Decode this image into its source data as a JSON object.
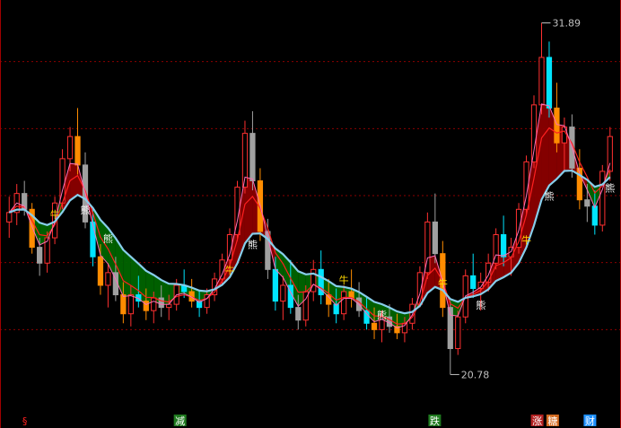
{
  "chart_data": {
    "type": "candlestick",
    "title": "",
    "price_max_label": "31.89",
    "price_min_label": "20.78",
    "y_range": [
      19.8,
      32.5
    ],
    "grid": {
      "horizontal_dashed": true,
      "color": "#8b0000"
    },
    "colors": {
      "background": "#000000",
      "candle_up": "#ff3030",
      "candle_down_a": "#00e5ff",
      "candle_down_b": "#ff8c00",
      "candle_neutral": "#a0a0a0",
      "band_bull": "#8b0000",
      "band_bear": "#006400",
      "ma_slow": "#87ceeb",
      "ma_fast": "#ff6fb5",
      "ma_mid": "#ff2020",
      "ma_bear": "#00a000"
    },
    "signals": [
      {
        "index": 6,
        "text": "牛",
        "kind": "bull"
      },
      {
        "index": 10,
        "text": "熊",
        "kind": "bear"
      },
      {
        "index": 13,
        "text": "熊",
        "kind": "bear"
      },
      {
        "index": 29,
        "text": "牛",
        "kind": "bull"
      },
      {
        "index": 32,
        "text": "熊",
        "kind": "bear"
      },
      {
        "index": 44,
        "text": "牛",
        "kind": "bull"
      },
      {
        "index": 49,
        "text": "熊",
        "kind": "bear"
      },
      {
        "index": 57,
        "text": "牛",
        "kind": "bull"
      },
      {
        "index": 62,
        "text": "熊",
        "kind": "bear"
      },
      {
        "index": 68,
        "text": "牛",
        "kind": "bull"
      },
      {
        "index": 71,
        "text": "熊",
        "kind": "bear"
      },
      {
        "index": 83,
        "text": "熊",
        "kind": "bear"
      }
    ],
    "bottom_markers": [
      {
        "x_frac": 0.04,
        "text": "§",
        "bg": "#000000",
        "fg": "#ff2020"
      },
      {
        "x_frac": 0.29,
        "text": "减",
        "bg": "#1f7a1f",
        "fg": "#ffffff"
      },
      {
        "x_frac": 0.7,
        "text": "跌",
        "bg": "#1f7a1f",
        "fg": "#ffffff"
      },
      {
        "x_frac": 0.865,
        "text": "涨",
        "bg": "#b22222",
        "fg": "#ffffff"
      },
      {
        "x_frac": 0.89,
        "text": "糖",
        "bg": "#d2691e",
        "fg": "#ffffff"
      },
      {
        "x_frac": 0.95,
        "text": "财",
        "bg": "#1e90ff",
        "fg": "#ffffff"
      }
    ],
    "candles": [
      [
        25.6,
        26.4,
        25.1,
        25.9
      ],
      [
        25.9,
        26.8,
        25.5,
        26.5
      ],
      [
        26.5,
        26.9,
        25.8,
        26.0
      ],
      [
        26.0,
        26.2,
        24.6,
        24.8
      ],
      [
        24.8,
        25.1,
        23.9,
        24.3
      ],
      [
        24.3,
        25.3,
        24.0,
        25.1
      ],
      [
        25.1,
        26.4,
        24.9,
        26.2
      ],
      [
        26.2,
        27.9,
        26.0,
        27.6
      ],
      [
        27.6,
        28.6,
        27.2,
        28.3
      ],
      [
        28.3,
        29.2,
        27.1,
        27.4
      ],
      [
        27.4,
        27.8,
        25.4,
        25.6
      ],
      [
        25.6,
        26.0,
        24.2,
        24.5
      ],
      [
        24.5,
        24.9,
        23.3,
        23.6
      ],
      [
        23.6,
        24.3,
        22.9,
        24.0
      ],
      [
        24.0,
        24.5,
        23.1,
        23.3
      ],
      [
        23.3,
        23.7,
        22.4,
        22.7
      ],
      [
        22.7,
        23.6,
        22.3,
        23.3
      ],
      [
        23.3,
        23.9,
        22.9,
        23.1
      ],
      [
        23.1,
        23.5,
        22.5,
        22.8
      ],
      [
        22.8,
        23.4,
        22.4,
        23.2
      ],
      [
        23.2,
        23.6,
        22.6,
        22.9
      ],
      [
        22.9,
        23.3,
        22.5,
        23.0
      ],
      [
        23.0,
        23.8,
        22.8,
        23.6
      ],
      [
        23.6,
        24.1,
        23.2,
        23.4
      ],
      [
        23.4,
        23.8,
        22.9,
        23.1
      ],
      [
        23.1,
        23.4,
        22.6,
        22.9
      ],
      [
        22.9,
        23.5,
        22.7,
        23.3
      ],
      [
        23.3,
        24.0,
        23.1,
        23.8
      ],
      [
        23.8,
        24.6,
        23.6,
        24.4
      ],
      [
        24.4,
        25.4,
        24.2,
        25.2
      ],
      [
        25.2,
        26.9,
        25.0,
        26.7
      ],
      [
        26.7,
        28.8,
        26.5,
        28.4
      ],
      [
        28.4,
        29.1,
        26.6,
        26.9
      ],
      [
        26.9,
        27.3,
        25.0,
        25.3
      ],
      [
        25.3,
        25.7,
        23.8,
        24.1
      ],
      [
        24.1,
        24.5,
        22.8,
        23.1
      ],
      [
        23.1,
        23.9,
        22.5,
        23.6
      ],
      [
        23.6,
        24.4,
        22.7,
        22.9
      ],
      [
        22.9,
        23.3,
        22.2,
        22.5
      ],
      [
        22.5,
        23.6,
        22.3,
        23.4
      ],
      [
        23.4,
        24.4,
        23.1,
        24.1
      ],
      [
        24.1,
        24.7,
        23.0,
        23.3
      ],
      [
        23.3,
        23.8,
        22.6,
        23.0
      ],
      [
        23.0,
        23.5,
        22.4,
        22.7
      ],
      [
        22.7,
        23.6,
        22.5,
        23.4
      ],
      [
        23.4,
        24.1,
        22.9,
        23.2
      ],
      [
        23.2,
        23.7,
        22.6,
        22.8
      ],
      [
        22.8,
        23.2,
        22.2,
        22.4
      ],
      [
        22.4,
        22.9,
        21.9,
        22.2
      ],
      [
        22.2,
        22.8,
        21.8,
        22.6
      ],
      [
        22.6,
        23.0,
        22.1,
        22.3
      ],
      [
        22.3,
        22.7,
        21.9,
        22.1
      ],
      [
        22.1,
        22.6,
        21.8,
        22.4
      ],
      [
        22.4,
        23.2,
        22.2,
        23.0
      ],
      [
        23.0,
        24.2,
        22.9,
        24.0
      ],
      [
        24.0,
        25.9,
        23.8,
        25.6
      ],
      [
        25.6,
        26.5,
        24.3,
        24.6
      ],
      [
        24.6,
        25.0,
        22.6,
        22.9
      ],
      [
        22.9,
        23.1,
        20.78,
        21.6
      ],
      [
        21.6,
        22.8,
        21.4,
        22.6
      ],
      [
        22.6,
        24.1,
        22.4,
        23.9
      ],
      [
        23.9,
        24.6,
        23.2,
        23.5
      ],
      [
        23.5,
        24.0,
        22.8,
        23.7
      ],
      [
        23.7,
        24.6,
        23.4,
        24.3
      ],
      [
        24.3,
        25.4,
        24.1,
        25.2
      ],
      [
        25.2,
        25.8,
        24.2,
        24.5
      ],
      [
        24.5,
        25.1,
        23.9,
        24.8
      ],
      [
        24.8,
        26.2,
        24.6,
        26.0
      ],
      [
        26.0,
        27.7,
        25.8,
        27.5
      ],
      [
        27.5,
        29.6,
        27.3,
        29.3
      ],
      [
        29.3,
        31.89,
        29.0,
        30.8
      ],
      [
        30.8,
        31.3,
        28.9,
        29.2
      ],
      [
        29.2,
        30.0,
        27.8,
        28.1
      ],
      [
        28.1,
        28.9,
        27.2,
        28.6
      ],
      [
        28.6,
        29.0,
        27.0,
        27.3
      ],
      [
        27.3,
        27.9,
        26.0,
        26.3
      ],
      [
        26.3,
        26.8,
        25.6,
        26.1
      ],
      [
        26.1,
        26.6,
        25.2,
        25.5
      ],
      [
        25.5,
        27.4,
        25.3,
        27.2
      ],
      [
        27.2,
        28.6,
        26.9,
        28.3
      ]
    ]
  }
}
